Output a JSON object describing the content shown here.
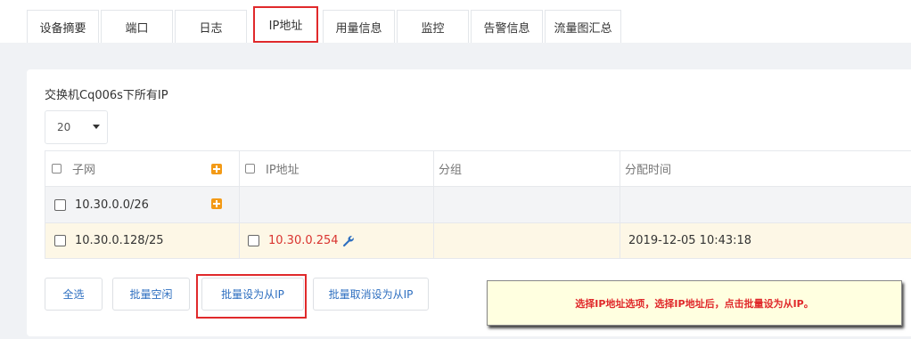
{
  "tabs": [
    {
      "label": "设备摘要"
    },
    {
      "label": "端口"
    },
    {
      "label": "日志"
    },
    {
      "label": "IP地址"
    },
    {
      "label": "用量信息"
    },
    {
      "label": "监控"
    },
    {
      "label": "告警信息"
    },
    {
      "label": "流量图汇总"
    }
  ],
  "card": {
    "title": "交换机Cq006s下所有IP",
    "page_size": "20"
  },
  "table": {
    "headers": [
      "子网",
      "IP地址",
      "分组",
      "分配时间"
    ],
    "rows": [
      {
        "subnet": "10.30.0.0/26",
        "ip": "",
        "group": "",
        "time": ""
      },
      {
        "subnet": "10.30.0.128/25",
        "ip": "10.30.0.254",
        "group": "",
        "time": "2019-12-05 10:43:18"
      }
    ]
  },
  "buttons": {
    "select_all": "全选",
    "batch_free": "批量空闲",
    "batch_set_secondary": "批量设为从IP",
    "batch_unset_secondary": "批量取消设为从IP"
  },
  "note": "选择IP地址选项，选择IP地址后，点击批量设为从IP。",
  "colors": {
    "highlight": "#e0292b",
    "accent_orange": "#f39a16",
    "link_blue": "#2e6fc0",
    "selected_row": "#fdf7e6"
  }
}
